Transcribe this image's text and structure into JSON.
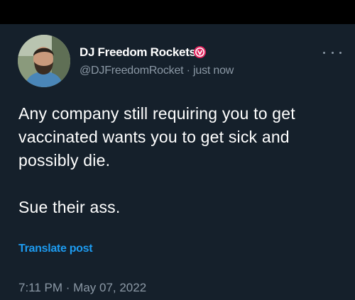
{
  "tweet": {
    "display_name": "DJ Freedom Rockets",
    "handle_line": "@DJFreedomRocket · just now",
    "badge_icon": "verified-badge-icon",
    "badge_color": "#e0245e",
    "more_icon": "more-options-icon",
    "text_lines": [
      "Any company still requiring you to get",
      "vaccinated wants you to get sick and",
      "possibly die."
    ],
    "text_line_2": "Sue their ass.",
    "translate_label": "Translate post",
    "timestamp": "7:11 PM · May 07, 2022"
  },
  "colors": {
    "background": "#15202b",
    "top_bar": "#000000",
    "link": "#1d9bf0",
    "muted": "#8b98a5"
  }
}
